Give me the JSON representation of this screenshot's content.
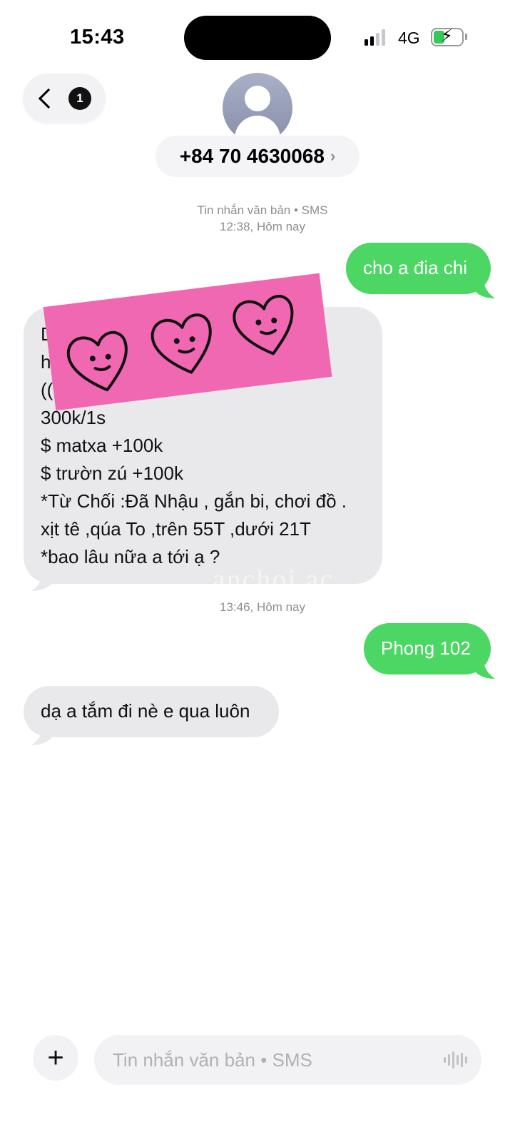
{
  "status_bar": {
    "time": "15:43",
    "network": "4G",
    "signal_bars_active": 2,
    "battery_color": "#34c759"
  },
  "header": {
    "back_badge": "1",
    "contact_number": "+84 70 4630068",
    "chevron": "›"
  },
  "conversation": {
    "meta1": {
      "label": "Tin nhắn văn bản • SMS",
      "time": "12:38, Hôm nay"
    },
    "meta2": {
      "time": "13:46, Hôm nay"
    },
    "messages": [
      {
        "direction": "out",
        "text": "cho a đia chi"
      },
      {
        "direction": "in",
        "lines": [
          "D",
          "h",
          "((",
          "300k/1s",
          "$ matxa +100k",
          "$ trườn zú +100k",
          "*Từ Chối :Đã Nhậu , gắn bi, chơi đồ .",
          "xịt tê ,qúa To ,trên 55T ,dưới 21T",
          "*bao lâu nữa a tới ạ ?"
        ]
      },
      {
        "direction": "out",
        "text": "Phong 102"
      },
      {
        "direction": "in",
        "text": "dạ a tắm đi nè e qua luôn"
      }
    ]
  },
  "watermark": "anchoi.ac",
  "composer": {
    "plus": "+",
    "placeholder": "Tin nhắn văn bản • SMS"
  },
  "colors": {
    "outgoing_bubble": "#4cd663",
    "incoming_bubble": "#e9e9eb",
    "sticker": "#f168b2"
  },
  "icons": [
    "back-chevron-icon",
    "avatar-icon",
    "heart-face-icon",
    "plus-icon",
    "audio-waveform-icon",
    "battery-icon",
    "signal-icon"
  ]
}
